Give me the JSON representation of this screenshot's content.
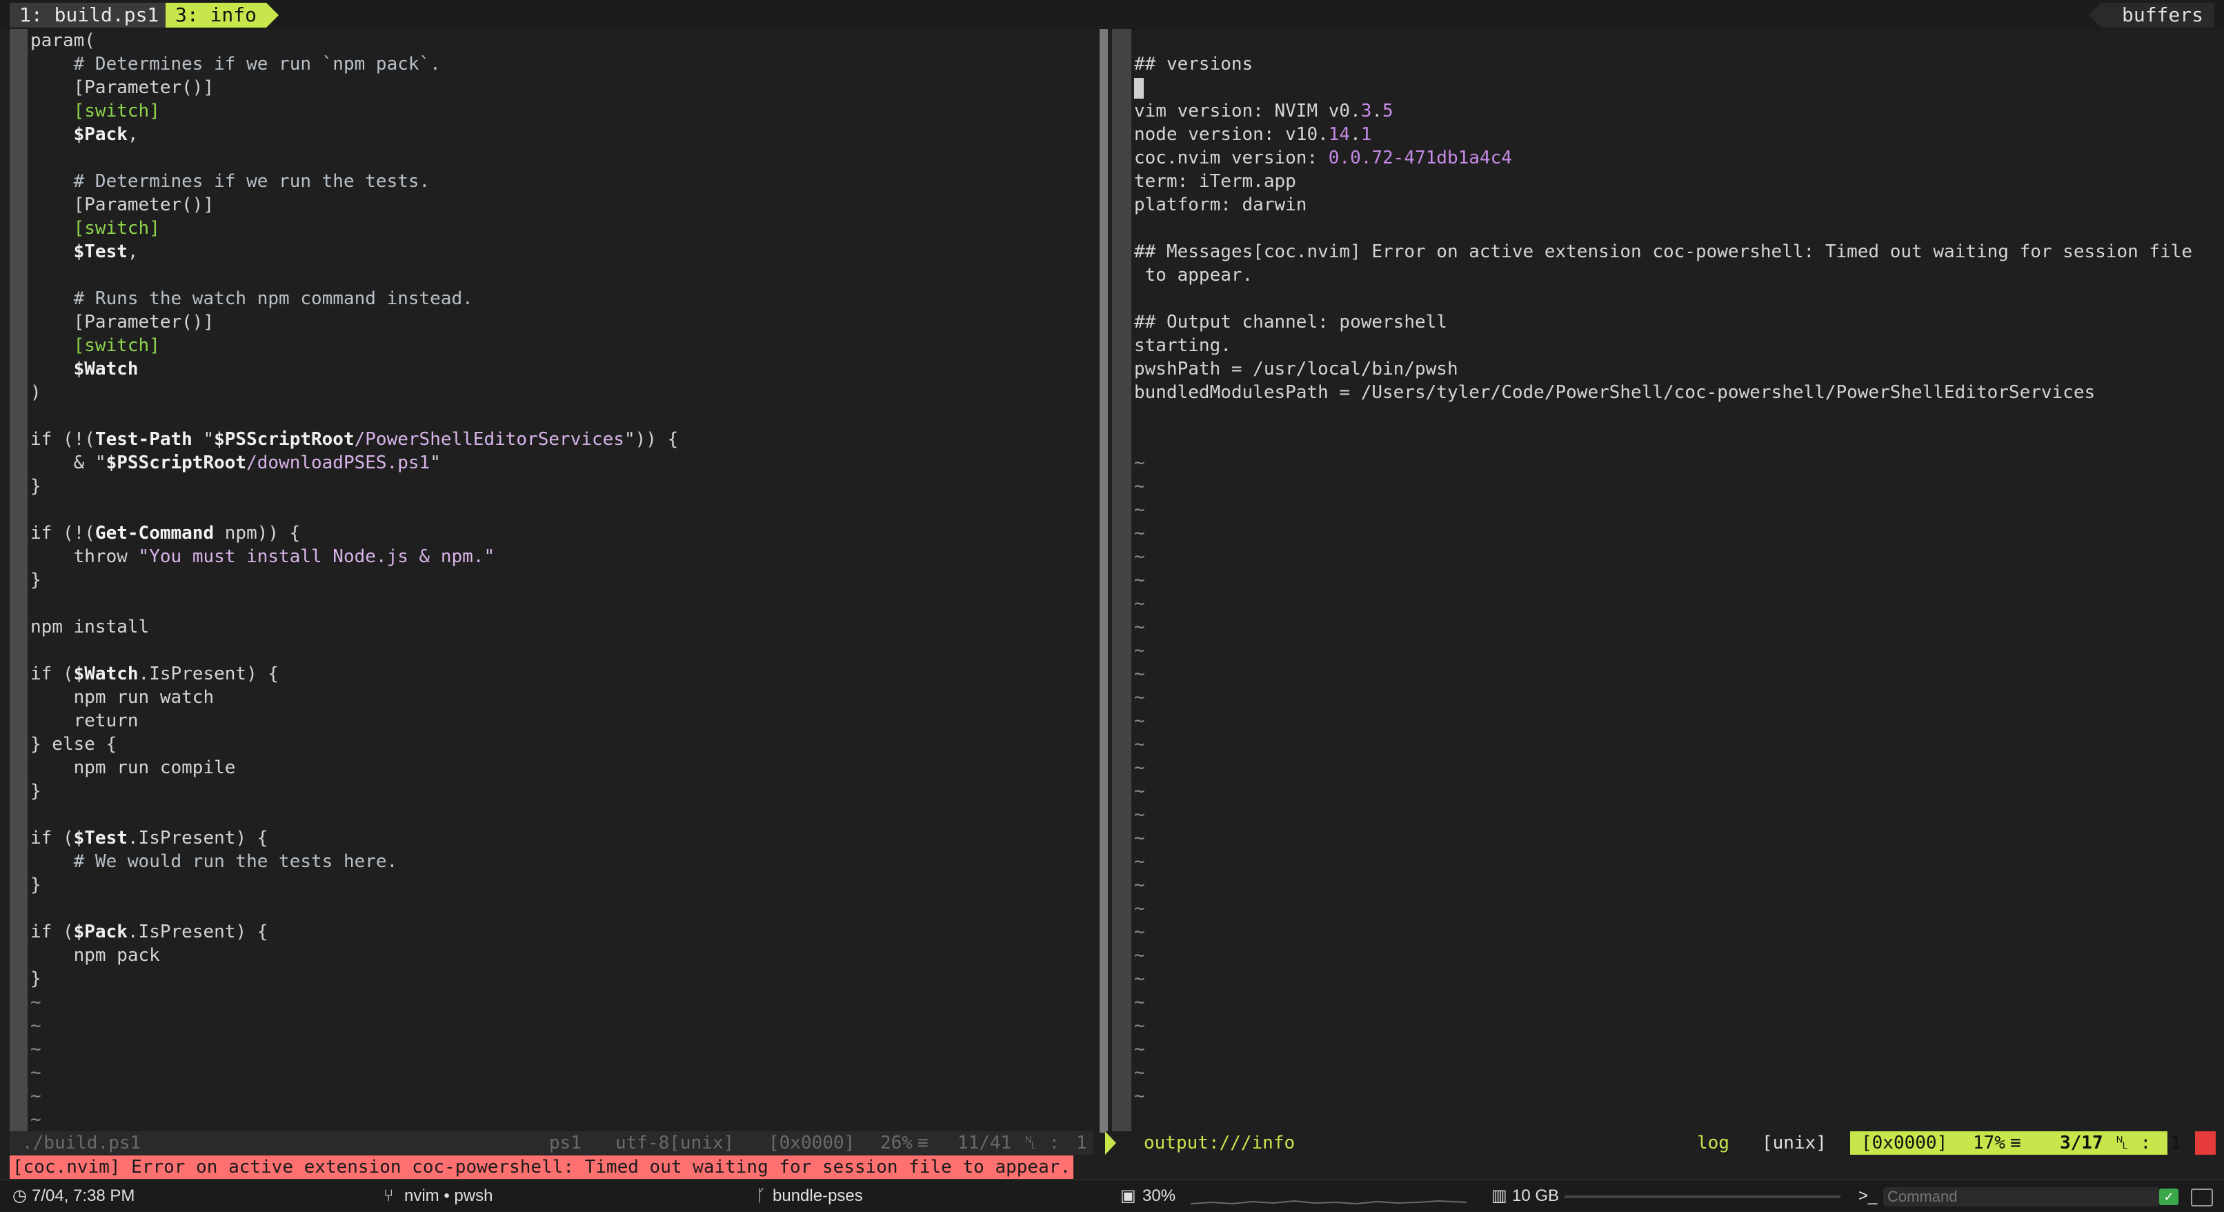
{
  "tabline": {
    "tab1": "1: build.ps1",
    "tab3": "3: info",
    "buffers": "buffers"
  },
  "left": {
    "lines": [
      [
        {
          "t": "param("
        }
      ],
      [
        {
          "t": "    "
        },
        {
          "t": "# Determines if we run `npm pack`.",
          "c": "c"
        }
      ],
      [
        {
          "t": "    [Parameter()]"
        }
      ],
      [
        {
          "t": "    "
        },
        {
          "t": "[switch]",
          "c": "g"
        }
      ],
      [
        {
          "t": "    "
        },
        {
          "t": "$Pack",
          "c": "v"
        },
        {
          "t": ","
        }
      ],
      [
        {
          "t": ""
        }
      ],
      [
        {
          "t": "    "
        },
        {
          "t": "# Determines if we run the tests.",
          "c": "c"
        }
      ],
      [
        {
          "t": "    [Parameter()]"
        }
      ],
      [
        {
          "t": "    "
        },
        {
          "t": "[switch]",
          "c": "g"
        }
      ],
      [
        {
          "t": "    "
        },
        {
          "t": "$Test",
          "c": "v"
        },
        {
          "t": ","
        }
      ],
      [
        {
          "t": ""
        }
      ],
      [
        {
          "t": "    "
        },
        {
          "t": "# Runs the watch npm command instead.",
          "c": "c"
        }
      ],
      [
        {
          "t": "    [Parameter()]"
        }
      ],
      [
        {
          "t": "    "
        },
        {
          "t": "[switch]",
          "c": "g"
        }
      ],
      [
        {
          "t": "    "
        },
        {
          "t": "$Watch",
          "c": "v"
        }
      ],
      [
        {
          "t": ")"
        }
      ],
      [
        {
          "t": ""
        }
      ],
      [
        {
          "t": "if (!("
        },
        {
          "t": "Test-Path",
          "c": "cmd"
        },
        {
          "t": " \""
        },
        {
          "t": "$PSScriptRoot",
          "c": "v"
        },
        {
          "t": "/PowerShellEditorServices",
          "c": "s"
        },
        {
          "t": "\")) {"
        }
      ],
      [
        {
          "t": "    & \""
        },
        {
          "t": "$PSScriptRoot",
          "c": "v"
        },
        {
          "t": "/downloadPSES.ps1",
          "c": "s"
        },
        {
          "t": "\""
        }
      ],
      [
        {
          "t": "}"
        }
      ],
      [
        {
          "t": ""
        }
      ],
      [
        {
          "t": "if (!("
        },
        {
          "t": "Get-Command",
          "c": "cmd"
        },
        {
          "t": " npm)) {"
        }
      ],
      [
        {
          "t": "    throw "
        },
        {
          "t": "\"You must install Node.js & npm.\"",
          "c": "s"
        }
      ],
      [
        {
          "t": "}"
        }
      ],
      [
        {
          "t": ""
        }
      ],
      [
        {
          "t": "npm install"
        }
      ],
      [
        {
          "t": ""
        }
      ],
      [
        {
          "t": "if ("
        },
        {
          "t": "$Watch",
          "c": "v"
        },
        {
          "t": ".IsPresent) {"
        }
      ],
      [
        {
          "t": "    npm run watch"
        }
      ],
      [
        {
          "t": "    return"
        }
      ],
      [
        {
          "t": "} else {"
        }
      ],
      [
        {
          "t": "    npm run compile"
        }
      ],
      [
        {
          "t": "}"
        }
      ],
      [
        {
          "t": ""
        }
      ],
      [
        {
          "t": "if ("
        },
        {
          "t": "$Test",
          "c": "v"
        },
        {
          "t": ".IsPresent) {"
        }
      ],
      [
        {
          "t": "    "
        },
        {
          "t": "# We would run the tests here.",
          "c": "c"
        }
      ],
      [
        {
          "t": "}"
        }
      ],
      [
        {
          "t": ""
        }
      ],
      [
        {
          "t": "if ("
        },
        {
          "t": "$Pack",
          "c": "v"
        },
        {
          "t": ".IsPresent) {"
        }
      ],
      [
        {
          "t": "    npm pack"
        }
      ],
      [
        {
          "t": "}"
        }
      ],
      [
        {
          "t": "~",
          "c": "tilde"
        }
      ],
      [
        {
          "t": "~",
          "c": "tilde"
        }
      ],
      [
        {
          "t": "~",
          "c": "tilde"
        }
      ],
      [
        {
          "t": "~",
          "c": "tilde"
        }
      ],
      [
        {
          "t": "~",
          "c": "tilde"
        }
      ],
      [
        {
          "t": "~",
          "c": "tilde"
        }
      ]
    ]
  },
  "right": {
    "lines": [
      [
        {
          "t": ""
        }
      ],
      [
        {
          "t": "## versions"
        }
      ],
      [
        {
          "t": "CURSOR"
        }
      ],
      [
        {
          "t": "vim version: NVIM v0."
        },
        {
          "t": "3",
          "c": "n"
        },
        {
          "t": "."
        },
        {
          "t": "5",
          "c": "n"
        }
      ],
      [
        {
          "t": "node version: v10."
        },
        {
          "t": "14",
          "c": "n"
        },
        {
          "t": "."
        },
        {
          "t": "1",
          "c": "n"
        }
      ],
      [
        {
          "t": "coc.nvim version: "
        },
        {
          "t": "0.0.72-471db1a4c4",
          "c": "n"
        }
      ],
      [
        {
          "t": "term: iTerm.app"
        }
      ],
      [
        {
          "t": "platform: darwin"
        }
      ],
      [
        {
          "t": ""
        }
      ],
      [
        {
          "t": "## Messages[coc.nvim] Error on active extension coc-powershell: Timed out waiting for session file"
        }
      ],
      [
        {
          "t": " to appear."
        }
      ],
      [
        {
          "t": ""
        }
      ],
      [
        {
          "t": "## Output channel: powershell"
        }
      ],
      [
        {
          "t": "starting."
        }
      ],
      [
        {
          "t": "pwshPath = /usr/local/bin/pwsh"
        }
      ],
      [
        {
          "t": "bundledModulesPath = /Users/tyler/Code/PowerShell/coc-powershell/PowerShellEditorServices"
        }
      ],
      [
        {
          "t": ""
        }
      ],
      [
        {
          "t": ""
        }
      ],
      [
        {
          "t": "~",
          "c": "tilde"
        }
      ],
      [
        {
          "t": "~",
          "c": "tilde"
        }
      ],
      [
        {
          "t": "~",
          "c": "tilde"
        }
      ],
      [
        {
          "t": "~",
          "c": "tilde"
        }
      ],
      [
        {
          "t": "~",
          "c": "tilde"
        }
      ],
      [
        {
          "t": "~",
          "c": "tilde"
        }
      ],
      [
        {
          "t": "~",
          "c": "tilde"
        }
      ],
      [
        {
          "t": "~",
          "c": "tilde"
        }
      ],
      [
        {
          "t": "~",
          "c": "tilde"
        }
      ],
      [
        {
          "t": "~",
          "c": "tilde"
        }
      ],
      [
        {
          "t": "~",
          "c": "tilde"
        }
      ],
      [
        {
          "t": "~",
          "c": "tilde"
        }
      ],
      [
        {
          "t": "~",
          "c": "tilde"
        }
      ],
      [
        {
          "t": "~",
          "c": "tilde"
        }
      ],
      [
        {
          "t": "~",
          "c": "tilde"
        }
      ],
      [
        {
          "t": "~",
          "c": "tilde"
        }
      ],
      [
        {
          "t": "~",
          "c": "tilde"
        }
      ],
      [
        {
          "t": "~",
          "c": "tilde"
        }
      ],
      [
        {
          "t": "~",
          "c": "tilde"
        }
      ],
      [
        {
          "t": "~",
          "c": "tilde"
        }
      ],
      [
        {
          "t": "~",
          "c": "tilde"
        }
      ],
      [
        {
          "t": "~",
          "c": "tilde"
        }
      ],
      [
        {
          "t": "~",
          "c": "tilde"
        }
      ],
      [
        {
          "t": "~",
          "c": "tilde"
        }
      ],
      [
        {
          "t": "~",
          "c": "tilde"
        }
      ],
      [
        {
          "t": "~",
          "c": "tilde"
        }
      ],
      [
        {
          "t": "~",
          "c": "tilde"
        }
      ],
      [
        {
          "t": "~",
          "c": "tilde"
        }
      ]
    ]
  },
  "status_left": {
    "file": "./build.ps1",
    "filetype": "ps1",
    "encoding": "utf-8[unix]",
    "char": "[0x0000]",
    "percent": "26%",
    "position": "11/41",
    "col": "1"
  },
  "status_right": {
    "file": "output:///info",
    "filetype": "log",
    "format": "[unix]",
    "char": "[0x0000]",
    "percent": "17%",
    "position": "3/17",
    "col": "1"
  },
  "message": "[coc.nvim] Error on active extension coc-powershell: Timed out waiting for session file to appear.",
  "bottom_bar": {
    "time": "7/04, 7:38 PM",
    "session": "nvim • pwsh",
    "branch": "bundle-pses",
    "cpu": "30%",
    "memory": "10 GB",
    "command_placeholder": "Command"
  },
  "colors": {
    "accent": "#c6e64b",
    "error_bg": "#ff7070",
    "string": "#d8b4e8",
    "type": "#8fd44c"
  }
}
